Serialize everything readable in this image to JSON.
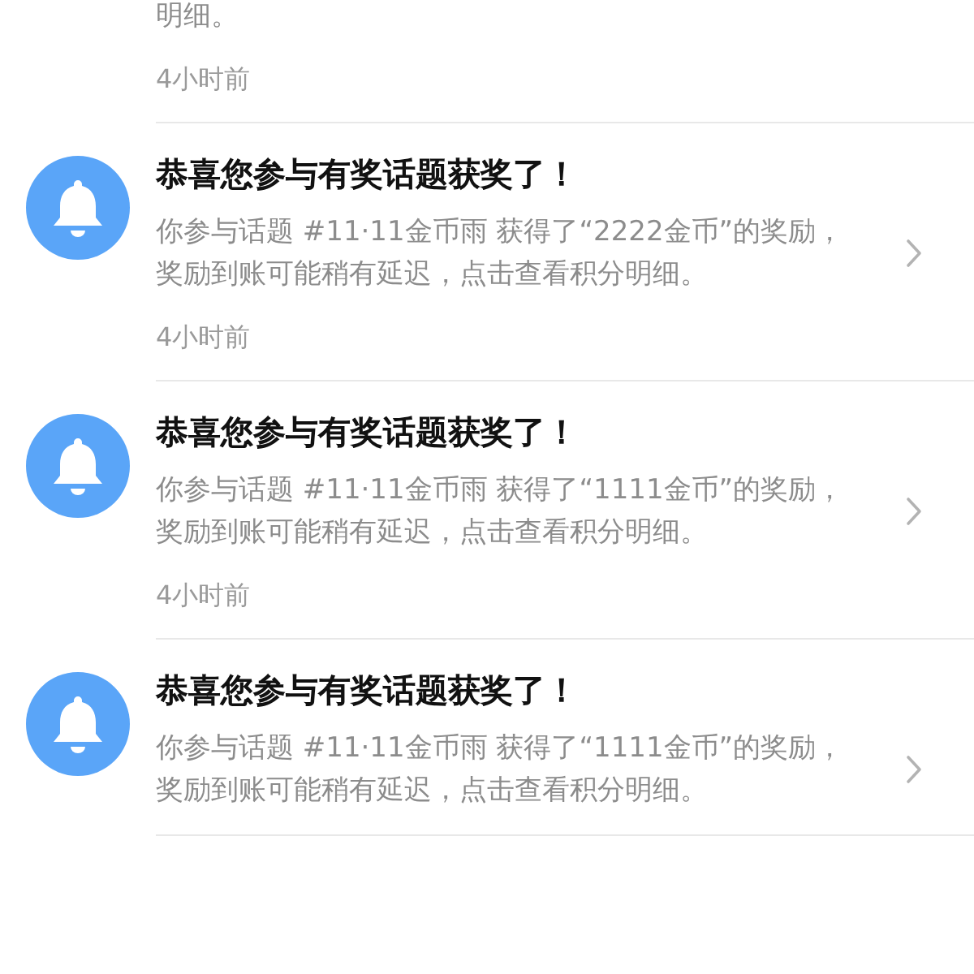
{
  "notifications": [
    {
      "kind": "partial",
      "body": "明细。",
      "time": "4小时前"
    },
    {
      "kind": "full",
      "title": "恭喜您参与有奖话题获奖了！",
      "body": "你参与话题 #11·11金币雨 获得了“2222金币”的奖励，奖励到账可能稍有延迟，点击查看积分明细。",
      "time": "4小时前"
    },
    {
      "kind": "full",
      "title": "恭喜您参与有奖话题获奖了！",
      "body": "你参与话题 #11·11金币雨 获得了“1111金币”的奖励，奖励到账可能稍有延迟，点击查看积分明细。",
      "time": "4小时前"
    },
    {
      "kind": "full",
      "title": "恭喜您参与有奖话题获奖了！",
      "body": "你参与话题 #11·11金币雨 获得了“1111金币”的奖励，奖励到账可能稍有延迟，点击查看积分明细。"
    }
  ]
}
